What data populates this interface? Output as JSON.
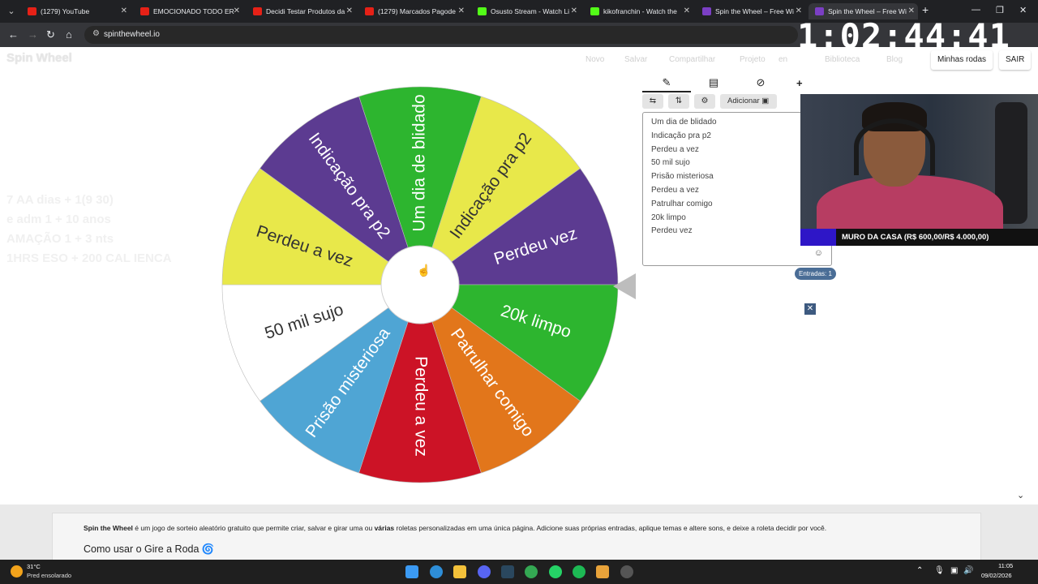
{
  "browser": {
    "tabs": [
      {
        "title": "(1279) YouTube",
        "color": "#e62117"
      },
      {
        "title": "EMOCIONADO TODO ER",
        "color": "#e62117"
      },
      {
        "title": "Decidi Testar Produtos da",
        "color": "#e62117"
      },
      {
        "title": "(1279) Marcados Pagode",
        "color": "#e62117"
      },
      {
        "title": "Osusto Stream - Watch Li",
        "color": "#53fc18"
      },
      {
        "title": "kikofranchin - Watch the",
        "color": "#53fc18"
      },
      {
        "title": "Spin the Wheel – Free Wi",
        "color": "#7b3fc4"
      },
      {
        "title": "Spin the Wheel – Free Wi",
        "color": "#7b3fc4"
      }
    ],
    "url": "spinthewheel.io"
  },
  "stream": {
    "timer": "1:02:44:41",
    "goal": {
      "text": "MURO DA CASA (R$ 600,00/R$ 4.000,00)",
      "progress": 0.15,
      "color": "#2e16c7"
    }
  },
  "header": {
    "logo": "Spin Wheel",
    "nav": [
      "Novo",
      "Salvar",
      "Compartilhar",
      "Projeto",
      "en",
      "Biblioteca",
      "Blog"
    ],
    "my_wheels": "Minhas rodas",
    "logout": "SAIR"
  },
  "ghost_lines": [
    "7 AA dias + 1(9 30)",
    "e adm 1 + 10 anos",
    "AMAÇÃO 1 + 3 nts",
    "1HRS ESO + 200 CAL IENCA"
  ],
  "wheel": {
    "segments": [
      {
        "label": "Um dia de blidado",
        "color": "#2db52f"
      },
      {
        "label": "Indicação pra p2",
        "color": "#e8e84a"
      },
      {
        "label": "Perdeu vez",
        "color": "#5c3b91"
      },
      {
        "label": "20k limpo",
        "color": "#2db52f"
      },
      {
        "label": "Patrulhar comigo",
        "color": "#e2761b"
      },
      {
        "label": "Perdeu a vez",
        "color": "#cc1326"
      },
      {
        "label": "Prisão misteriosa",
        "color": "#4fa5d4"
      },
      {
        "label": "50 mil sujo",
        "color": "#ffffff"
      },
      {
        "label": "Perdeu a vez",
        "color": "#e8e84a"
      },
      {
        "label": "Indicação pra p2",
        "color": "#5c3b91"
      }
    ]
  },
  "editor": {
    "tabs": [
      "edit",
      "results",
      "hide"
    ],
    "add_button": "Adicionar",
    "entries": [
      "Um dia de blidado",
      "Indicação pra p2",
      "Perdeu a vez",
      "50 mil sujo",
      "Prisão misteriosa",
      "Perdeu a vez",
      "Patrulhar comigo",
      "20k limpo",
      "Perdeu vez"
    ],
    "count_label": "Entradas: 1"
  },
  "info": {
    "brand": "Spin the Wheel",
    "desc_part1": " é um jogo de sorteio aleatório gratuito que permite criar, salvar e girar uma ou ",
    "desc_bold": "várias",
    "desc_part2": " roletas personalizadas em uma única página. Adicione suas próprias entradas, aplique temas e altere sons, e deixe a roleta decidir por você.",
    "heading": "Como usar o Gire a Roda"
  },
  "taskbar": {
    "temp": "31°C",
    "weather": "Pred ensolarado",
    "time": "11:05",
    "date": "09/02/2026"
  }
}
